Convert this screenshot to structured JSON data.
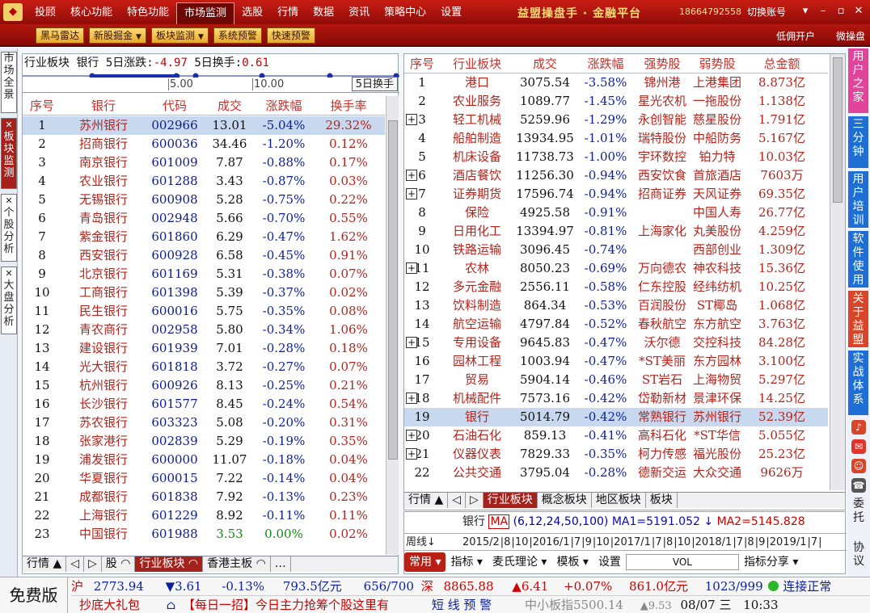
{
  "window": {
    "menu": [
      "投顾",
      "核心功能",
      "特色功能",
      "市场监测",
      "选股",
      "行情",
      "数据",
      "资讯",
      "策略中心",
      "设置"
    ],
    "active_menu": "市场监测",
    "brand": "益盟操盘手 · 金融平台",
    "phone": "18664792558",
    "switch_account": "切换账号"
  },
  "toolbar": {
    "buttons": [
      {
        "label": "黑马雷达",
        "dropdown": false
      },
      {
        "label": "新股掘金",
        "dropdown": true
      },
      {
        "label": "板块监测",
        "dropdown": true
      },
      {
        "label": "系统预警",
        "dropdown": false
      },
      {
        "label": "快速预警",
        "dropdown": false
      }
    ],
    "right_links": [
      "低佣开户",
      "微操盘"
    ]
  },
  "left_tabs": [
    {
      "label": "市场全景",
      "closable": false,
      "active": false
    },
    {
      "label": "板块监测",
      "closable": true,
      "active": true
    },
    {
      "label": "个股分析",
      "closable": true,
      "active": false
    },
    {
      "label": "大盘分析",
      "closable": true,
      "active": false
    }
  ],
  "right_tabs": [
    {
      "label": "用户之家",
      "color": "#e0459a"
    },
    {
      "label": "三分钟",
      "color": "#1d6fd6"
    },
    {
      "label": "用户培训",
      "color": "#1d6fd6"
    },
    {
      "label": "软件使用",
      "color": "#1d6fd6"
    },
    {
      "label": "关于益盟",
      "color": "#d8462a"
    },
    {
      "label": "实战体系",
      "color": "#1d6fd6"
    }
  ],
  "right_icons": [
    "bell-icon",
    "chat-icon",
    "user-icon",
    "call-icon"
  ],
  "right_texts": [
    "委托",
    "协议"
  ],
  "left_panel": {
    "info": {
      "prefix": "行业板块",
      "name": "银行",
      "change_label": "5日涨跌:",
      "change": "-4.97",
      "turnover_label": "5日换手:",
      "turnover": "0.61"
    },
    "ruler": {
      "labels": [
        "5.00",
        "10.00"
      ],
      "button": "5日换手"
    },
    "headers": [
      "序号",
      "银行",
      "代码",
      "成交",
      "涨跌幅",
      "换手率"
    ],
    "rows": [
      [
        "1",
        "苏州银行",
        "002966",
        "13.01",
        "-5.04%",
        "29.32%"
      ],
      [
        "2",
        "招商银行",
        "600036",
        "34.46",
        "-1.20%",
        "0.12%"
      ],
      [
        "3",
        "南京银行",
        "601009",
        "7.87",
        "-0.88%",
        "0.17%"
      ],
      [
        "4",
        "农业银行",
        "601288",
        "3.43",
        "-0.87%",
        "0.03%"
      ],
      [
        "5",
        "无锡银行",
        "600908",
        "5.28",
        "-0.75%",
        "0.22%"
      ],
      [
        "6",
        "青岛银行",
        "002948",
        "5.66",
        "-0.70%",
        "0.55%"
      ],
      [
        "7",
        "紫金银行",
        "601860",
        "6.29",
        "-0.47%",
        "1.62%"
      ],
      [
        "8",
        "西安银行",
        "600928",
        "6.58",
        "-0.45%",
        "0.91%"
      ],
      [
        "9",
        "北京银行",
        "601169",
        "5.31",
        "-0.38%",
        "0.07%"
      ],
      [
        "10",
        "工商银行",
        "601398",
        "5.39",
        "-0.37%",
        "0.02%"
      ],
      [
        "11",
        "民生银行",
        "600016",
        "5.75",
        "-0.35%",
        "0.08%"
      ],
      [
        "12",
        "青农商行",
        "002958",
        "5.80",
        "-0.34%",
        "1.06%"
      ],
      [
        "13",
        "建设银行",
        "601939",
        "7.01",
        "-0.28%",
        "0.18%"
      ],
      [
        "14",
        "光大银行",
        "601818",
        "3.72",
        "-0.27%",
        "0.07%"
      ],
      [
        "15",
        "杭州银行",
        "600926",
        "8.13",
        "-0.25%",
        "0.21%"
      ],
      [
        "16",
        "长沙银行",
        "601577",
        "8.45",
        "-0.24%",
        "0.54%"
      ],
      [
        "17",
        "苏农银行",
        "603323",
        "5.08",
        "-0.20%",
        "0.31%"
      ],
      [
        "18",
        "张家港行",
        "002839",
        "5.29",
        "-0.19%",
        "0.35%"
      ],
      [
        "19",
        "浦发银行",
        "600000",
        "11.07",
        "-0.18%",
        "0.04%"
      ],
      [
        "20",
        "华夏银行",
        "600015",
        "7.22",
        "-0.14%",
        "0.04%"
      ],
      [
        "21",
        "成都银行",
        "601838",
        "7.92",
        "-0.13%",
        "0.23%"
      ],
      [
        "22",
        "上海银行",
        "601229",
        "8.92",
        "-0.11%",
        "0.11%"
      ],
      [
        "23",
        "中国银行",
        "601988",
        "3.53",
        "0.00%",
        "0.02%"
      ]
    ],
    "tabs": [
      "行情 ▲",
      "◁",
      "▷",
      "股 ◠",
      "行业板块 ◠",
      "香港主板 ◠",
      "…"
    ]
  },
  "right_panel": {
    "headers": [
      "序号",
      "行业板块",
      "成交",
      "涨跌幅",
      "强势股",
      "弱势股",
      "总金额"
    ],
    "rows": [
      {
        "plus": false,
        "c": [
          "1",
          "港口",
          "3075.54",
          "-3.58%",
          "锦州港",
          "上港集团",
          "8.873亿"
        ]
      },
      {
        "plus": false,
        "c": [
          "2",
          "农业服务",
          "1089.77",
          "-1.45%",
          "星光农机",
          "一拖股份",
          "1.138亿"
        ]
      },
      {
        "plus": true,
        "c": [
          "3",
          "轻工机械",
          "5259.96",
          "-1.29%",
          "永创智能",
          "慈星股份",
          "1.791亿"
        ]
      },
      {
        "plus": false,
        "c": [
          "4",
          "船舶制造",
          "13934.95",
          "-1.01%",
          "瑞特股份",
          "中船防务",
          "5.167亿"
        ]
      },
      {
        "plus": false,
        "c": [
          "5",
          "机床设备",
          "11738.73",
          "-1.00%",
          "宇环数控",
          "铂力特",
          "10.03亿"
        ]
      },
      {
        "plus": true,
        "c": [
          "6",
          "酒店餐饮",
          "11256.30",
          "-0.94%",
          "西安饮食",
          "首旅酒店",
          "7603万"
        ]
      },
      {
        "plus": true,
        "c": [
          "7",
          "证券期货",
          "17596.74",
          "-0.94%",
          "招商证券",
          "天风证券",
          "69.35亿"
        ]
      },
      {
        "plus": false,
        "c": [
          "8",
          "保险",
          "4925.58",
          "-0.91%",
          "",
          "中国人寿",
          "26.77亿"
        ]
      },
      {
        "plus": false,
        "c": [
          "9",
          "日用化工",
          "13394.97",
          "-0.81%",
          "上海家化",
          "丸美股份",
          "4.259亿"
        ]
      },
      {
        "plus": false,
        "c": [
          "10",
          "铁路运输",
          "3096.45",
          "-0.74%",
          "",
          "西部创业",
          "1.309亿"
        ]
      },
      {
        "plus": true,
        "c": [
          "11",
          "农林",
          "8050.23",
          "-0.69%",
          "万向德农",
          "神农科技",
          "15.36亿"
        ]
      },
      {
        "plus": false,
        "c": [
          "12",
          "多元金融",
          "2556.11",
          "-0.58%",
          "仁东控股",
          "经纬纺机",
          "10.25亿"
        ]
      },
      {
        "plus": false,
        "c": [
          "13",
          "饮料制造",
          "864.34",
          "-0.53%",
          "百润股份",
          "ST椰岛",
          "1.068亿"
        ]
      },
      {
        "plus": false,
        "c": [
          "14",
          "航空运输",
          "4797.84",
          "-0.52%",
          "春秋航空",
          "东方航空",
          "3.763亿"
        ]
      },
      {
        "plus": true,
        "c": [
          "15",
          "专用设备",
          "9645.83",
          "-0.47%",
          "沃尔德",
          "交控科技",
          "84.28亿"
        ]
      },
      {
        "plus": false,
        "c": [
          "16",
          "园林工程",
          "1003.94",
          "-0.47%",
          "*ST美丽",
          "东方园林",
          "3.100亿"
        ]
      },
      {
        "plus": false,
        "c": [
          "17",
          "贸易",
          "5904.14",
          "-0.46%",
          "ST岩石",
          "上海物贸",
          "5.297亿"
        ]
      },
      {
        "plus": true,
        "c": [
          "18",
          "机械配件",
          "7573.16",
          "-0.42%",
          "岱勒新材",
          "景津环保",
          "14.25亿"
        ]
      },
      {
        "plus": false,
        "c": [
          "19",
          "银行",
          "5014.79",
          "-0.42%",
          "常熟银行",
          "苏州银行",
          "52.39亿"
        ]
      },
      {
        "plus": true,
        "c": [
          "20",
          "石油石化",
          "859.13",
          "-0.41%",
          "高科石化",
          "*ST华信",
          "5.055亿"
        ]
      },
      {
        "plus": true,
        "c": [
          "21",
          "仪器仪表",
          "7829.33",
          "-0.35%",
          "柯力传感",
          "福光股份",
          "25.23亿"
        ]
      },
      {
        "plus": false,
        "c": [
          "22",
          "公共交通",
          "3795.04",
          "-0.28%",
          "德新交运",
          "大众交通",
          "9626万"
        ]
      }
    ],
    "tabs": [
      "行情 ▲",
      "◁",
      "▷",
      "行业板块",
      "概念板块",
      "地区板块",
      "板块"
    ]
  },
  "chart_panel": {
    "name": "银行",
    "ma_label": "MA",
    "ma_params": "(6,12,24,50,100)",
    "ma1": "MA1=5191.052",
    "ma2": "MA2=5145.828",
    "period": "周线",
    "dates": [
      "2015/2",
      "8",
      "10",
      "2016/1",
      "7",
      "9",
      "10",
      "2017/1",
      "7",
      "8",
      "10",
      "2018/1",
      "7",
      "8",
      "9",
      "2019/1",
      "7"
    ],
    "tools": [
      "常用",
      "指标",
      "麦氏理论",
      "模板",
      "设置",
      "VOL",
      "指标分享"
    ]
  },
  "status": {
    "free": "免费版",
    "sh_label": "沪",
    "sh_index": "2773.94",
    "sh_change": "▼3.61",
    "sh_pct": "-0.13%",
    "sh_amount": "793.5亿元",
    "sh_count": "656/700",
    "sz_label": "深",
    "sz_index": "8865.88",
    "sz_change": "▲6.41",
    "sz_pct": "+0.07%",
    "sz_amount": "861.0亿元",
    "sz_count": "1023/999",
    "conn": "连接正常",
    "promo": "抄底大礼包",
    "news": "【每日一招】今日主力抢筹个股这里有",
    "alert": "短 线 预 警",
    "board": "中小板指5500.14",
    "board_change": "▲9.53",
    "date": "08/07 三",
    "time": "10:33"
  }
}
